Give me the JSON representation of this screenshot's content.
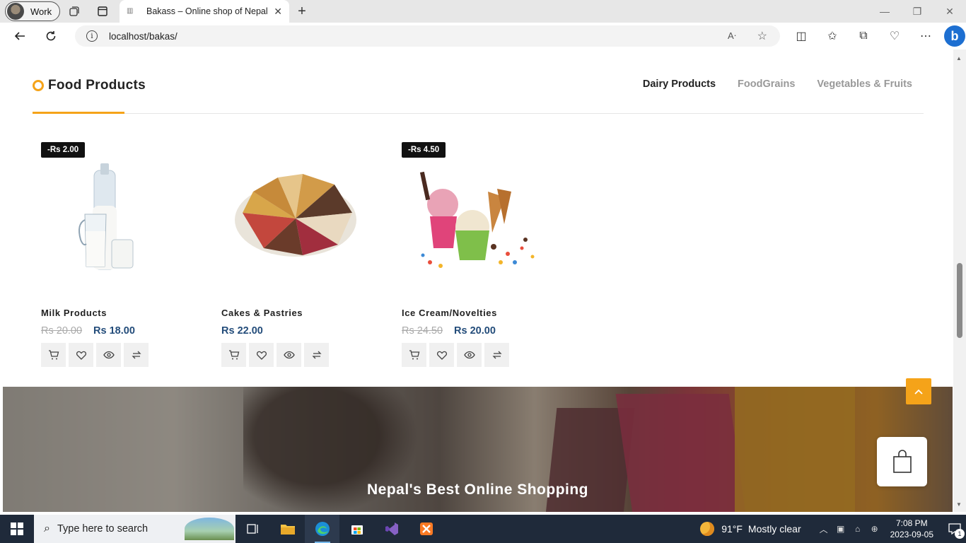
{
  "browser": {
    "profile_label": "Work",
    "tab_title": "Bakass – Online shop of Nepal",
    "url": "localhost/bakas/"
  },
  "section": {
    "title": "Food Products",
    "tabs": [
      {
        "label": "Dairy Products",
        "active": true
      },
      {
        "label": "FoodGrains",
        "active": false
      },
      {
        "label": "Vegetables & Fruits",
        "active": false
      }
    ],
    "accent_color": "#f5a319"
  },
  "products": [
    {
      "name": "Milk Products",
      "badge": "-Rs 2.00",
      "old_price": "Rs 20.00",
      "price": "Rs 18.00",
      "image": "milk-jugs"
    },
    {
      "name": "Cakes & Pastries",
      "badge": "",
      "old_price": "",
      "price": "Rs 22.00",
      "image": "cake-slices"
    },
    {
      "name": "Ice Cream/Novelties",
      "badge": "-Rs 4.50",
      "old_price": "Rs 24.50",
      "price": "Rs 20.00",
      "image": "ice-cream-cups"
    }
  ],
  "banner": {
    "heading": "Nepal's Best Online Shopping"
  },
  "taskbar": {
    "search_placeholder": "Type here to search",
    "weather_temp": "91°F",
    "weather_desc": "Mostly clear",
    "time": "7:08 PM",
    "date": "2023-09-05",
    "notifications": "1"
  }
}
